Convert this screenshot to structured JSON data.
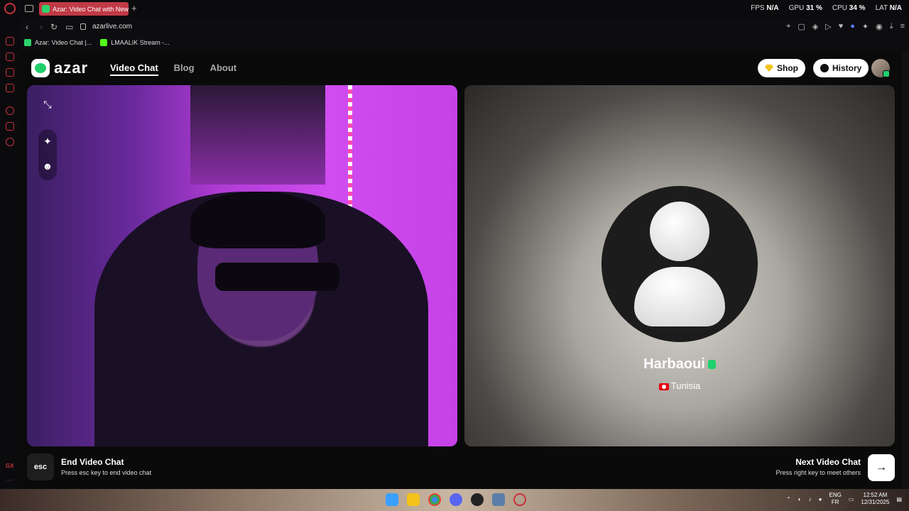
{
  "browser": {
    "tab_title": "Azar: Video Chat with New",
    "new_tab_glyph": "+",
    "url": "azarlive.com",
    "stats": [
      {
        "label": "FPS",
        "value": "N/A"
      },
      {
        "label": "GPU",
        "value": "31 %"
      },
      {
        "label": "CPU",
        "value": "34 %"
      },
      {
        "label": "LAT",
        "value": "N/A"
      }
    ],
    "bookmarks": [
      {
        "label": "Azar: Video Chat |...",
        "color": "#2bd46b"
      },
      {
        "label": "LMAALIK Stream -...",
        "color": "#53fc18"
      }
    ],
    "sidebar_label": "GX"
  },
  "site": {
    "logo_text": "azar",
    "nav": {
      "video_chat": "Video Chat",
      "blog": "Blog",
      "about": "About"
    },
    "shop_label": "Shop",
    "history_label": "History"
  },
  "peer": {
    "name": "Harbaoui",
    "country": "Tunisia"
  },
  "controls": {
    "esc_key": "esc",
    "end_title": "End Video Chat",
    "end_subtitle": "Press esc key to end video chat",
    "next_title": "Next Video Chat",
    "next_subtitle": "Press right key to meet others",
    "next_glyph": "→"
  },
  "taskbar": {
    "lang_top": "ENG",
    "lang_bottom": "FR",
    "time": "12:52 AM",
    "date": "12/31/2025"
  },
  "colors": {
    "accent_green": "#1fcf6b",
    "gx_red": "#c8323a"
  }
}
